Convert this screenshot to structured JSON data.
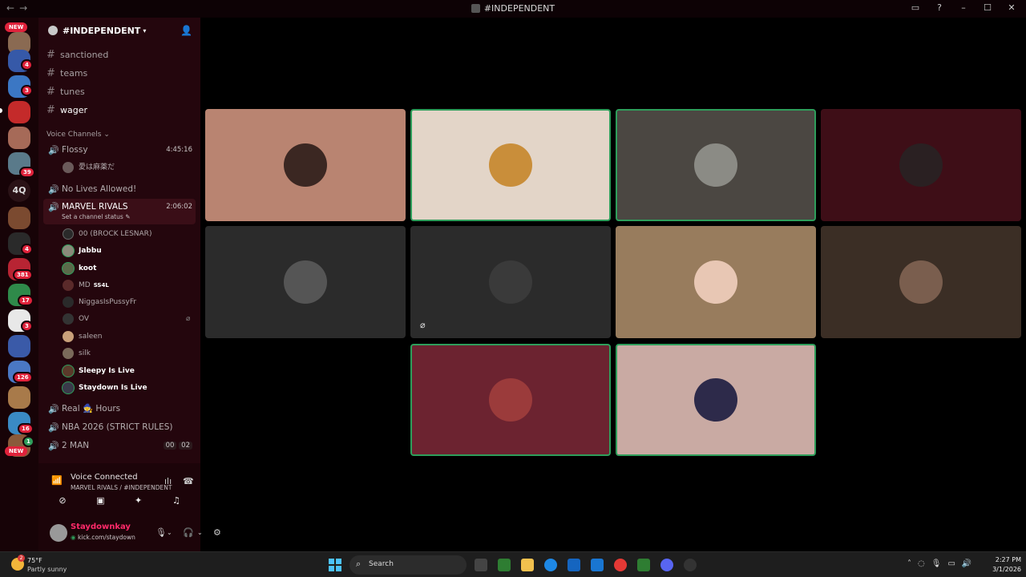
{
  "window": {
    "title": "#INDEPENDENT",
    "back_glyph": "←",
    "forward_glyph": "→"
  },
  "server_rail": {
    "new_badge_top": "NEW",
    "new_badge_bottom": "NEW",
    "text_server": "4Q",
    "badges": [
      "4",
      "3",
      "39",
      "4",
      "3",
      "381",
      "17",
      "3",
      "126",
      "16",
      "1"
    ]
  },
  "channel_sidebar": {
    "server_name": "#INDEPENDENT",
    "text_channels": [
      {
        "name": "sanctioned",
        "active": false
      },
      {
        "name": "teams",
        "active": false
      },
      {
        "name": "tunes",
        "active": false
      },
      {
        "name": "wager",
        "active": true
      }
    ],
    "voice_category": "Voice Channels",
    "voice_channels": {
      "flossy": {
        "name": "Flossy",
        "time": "4:45:16",
        "member": "愛は麻薬だ"
      },
      "no_lives": {
        "name": "No Lives Allowed!"
      },
      "marvel": {
        "name": "MARVEL RIVALS",
        "time": "2:06:02",
        "status": "Set a channel status"
      },
      "real_hours": {
        "name": "Real 🧙 Hours"
      },
      "nba": {
        "name": "NBA 2026 (STRICT RULES)"
      },
      "two_man": {
        "name": "2 MAN",
        "count_a": "00",
        "count_b": "02"
      }
    },
    "marvel_members": [
      {
        "name": "00 (BROCK LESNAR)",
        "bold": false
      },
      {
        "name": "Jabbu",
        "bold": true
      },
      {
        "name": "koot",
        "bold": true
      },
      {
        "name": "MD",
        "tag": "SS4L",
        "bold": false
      },
      {
        "name": "NiggasIsPussyFr",
        "bold": false
      },
      {
        "name": "OV",
        "bold": false
      },
      {
        "name": "saleen",
        "bold": false
      },
      {
        "name": "silk",
        "bold": false
      },
      {
        "name": "Sleepy Is Live",
        "bold": true
      },
      {
        "name": "Staydown Is Live",
        "bold": true
      }
    ]
  },
  "voice_panel": {
    "status": "Voice Connected",
    "channel_path": "MARVEL RIVALS / #INDEPENDENT"
  },
  "user_panel": {
    "username": "Staydownkay",
    "status_text": "kick.com/staydown"
  },
  "call_tiles": [
    {
      "color": "#b98471",
      "speaking": false,
      "avatar_color": "#3b2722"
    },
    {
      "color": "#e3d5c8",
      "speaking": true,
      "avatar_color": "#c98e3a"
    },
    {
      "color": "#4b4742",
      "speaking": true,
      "avatar_color": "#8b8b85"
    },
    {
      "color": "#3e0e17",
      "speaking": false,
      "avatar_color": "#2a2022"
    },
    {
      "color": "#2b2b2b",
      "speaking": false,
      "avatar_color": "#555555"
    },
    {
      "color": "#2b2b2b",
      "speaking": false,
      "avatar_color": "#3a3a3a",
      "muted": true
    },
    {
      "color": "#987c5d",
      "speaking": false,
      "avatar_color": "#e8c7b4"
    },
    {
      "color": "#3b2e25",
      "speaking": false,
      "avatar_color": "#7a5e4e"
    },
    {
      "color": "#6c2330",
      "speaking": true,
      "avatar_color": "#9b3b3b"
    },
    {
      "color": "#c9aaa3",
      "speaking": true,
      "avatar_color": "#2d2a4a"
    }
  ],
  "taskbar": {
    "temp": "75°F",
    "condition": "Partly sunny",
    "weather_badge": "2",
    "search_placeholder": "Search",
    "time": "2:27 PM",
    "date": "3/1/2026"
  },
  "colors": {
    "accent_green": "#2e9e5b",
    "username_pink": "#ff2a6a",
    "badge_red": "#e0223b"
  },
  "icons": {
    "titlebar": [
      "screen-share-icon",
      "help-icon",
      "minimize-icon",
      "maximize-icon",
      "close-icon"
    ],
    "voice_controls": [
      "camera-off-icon",
      "screen-share-icon",
      "activities-icon",
      "soundboard-icon"
    ],
    "user_controls": [
      "microphone-icon",
      "headphones-icon",
      "settings-gear-icon"
    ]
  }
}
